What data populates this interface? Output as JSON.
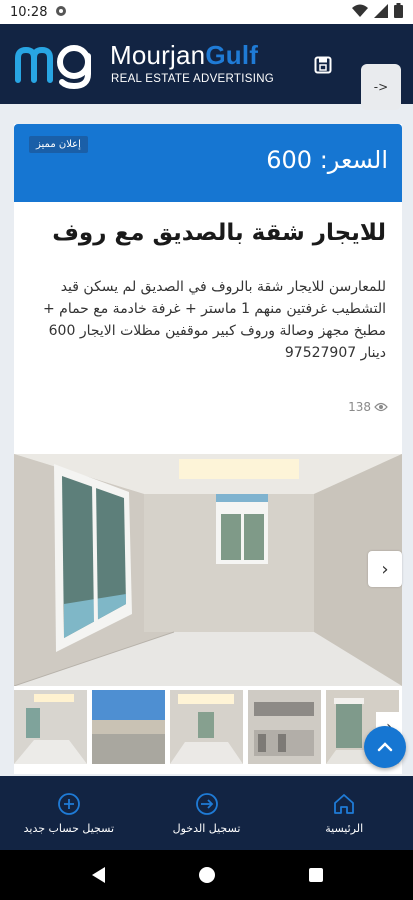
{
  "status_bar": {
    "time": "10:28"
  },
  "header": {
    "brand_main": "Mourjan",
    "brand_accent": "Gulf",
    "tagline": "REAL ESTATE ADVERTISING",
    "menu_label": "->",
    "brand_color": "#122443",
    "accent_color": "#1f7bd6"
  },
  "listing": {
    "badge": "إعلان مميز",
    "price": "السعر: 600",
    "title": "للايجار شقة بالصديق مع روف",
    "description": "للمعارسن للايجار شقة بالروف في الصديق لم يسكن قيد التشطيب غرفتين منهم 1 ماستر + غرفة خادمة مع حمام + مطبخ مجهز وصالة وروف كبير موقفين مظلات الايجار 600 دينار 97527907",
    "views": "138",
    "next_label": "›",
    "thumbs_next_label": "›"
  },
  "bottom_nav": {
    "items": [
      {
        "label": "تسجيل حساب جديد",
        "icon": "add-circle-icon"
      },
      {
        "label": "تسجيل الدخول",
        "icon": "login-icon"
      },
      {
        "label": "الرئيسية",
        "icon": "home-icon"
      }
    ]
  },
  "colors": {
    "nav_bg": "#122443",
    "price_banner": "#1676d2",
    "page_bg": "#e9edf2"
  }
}
